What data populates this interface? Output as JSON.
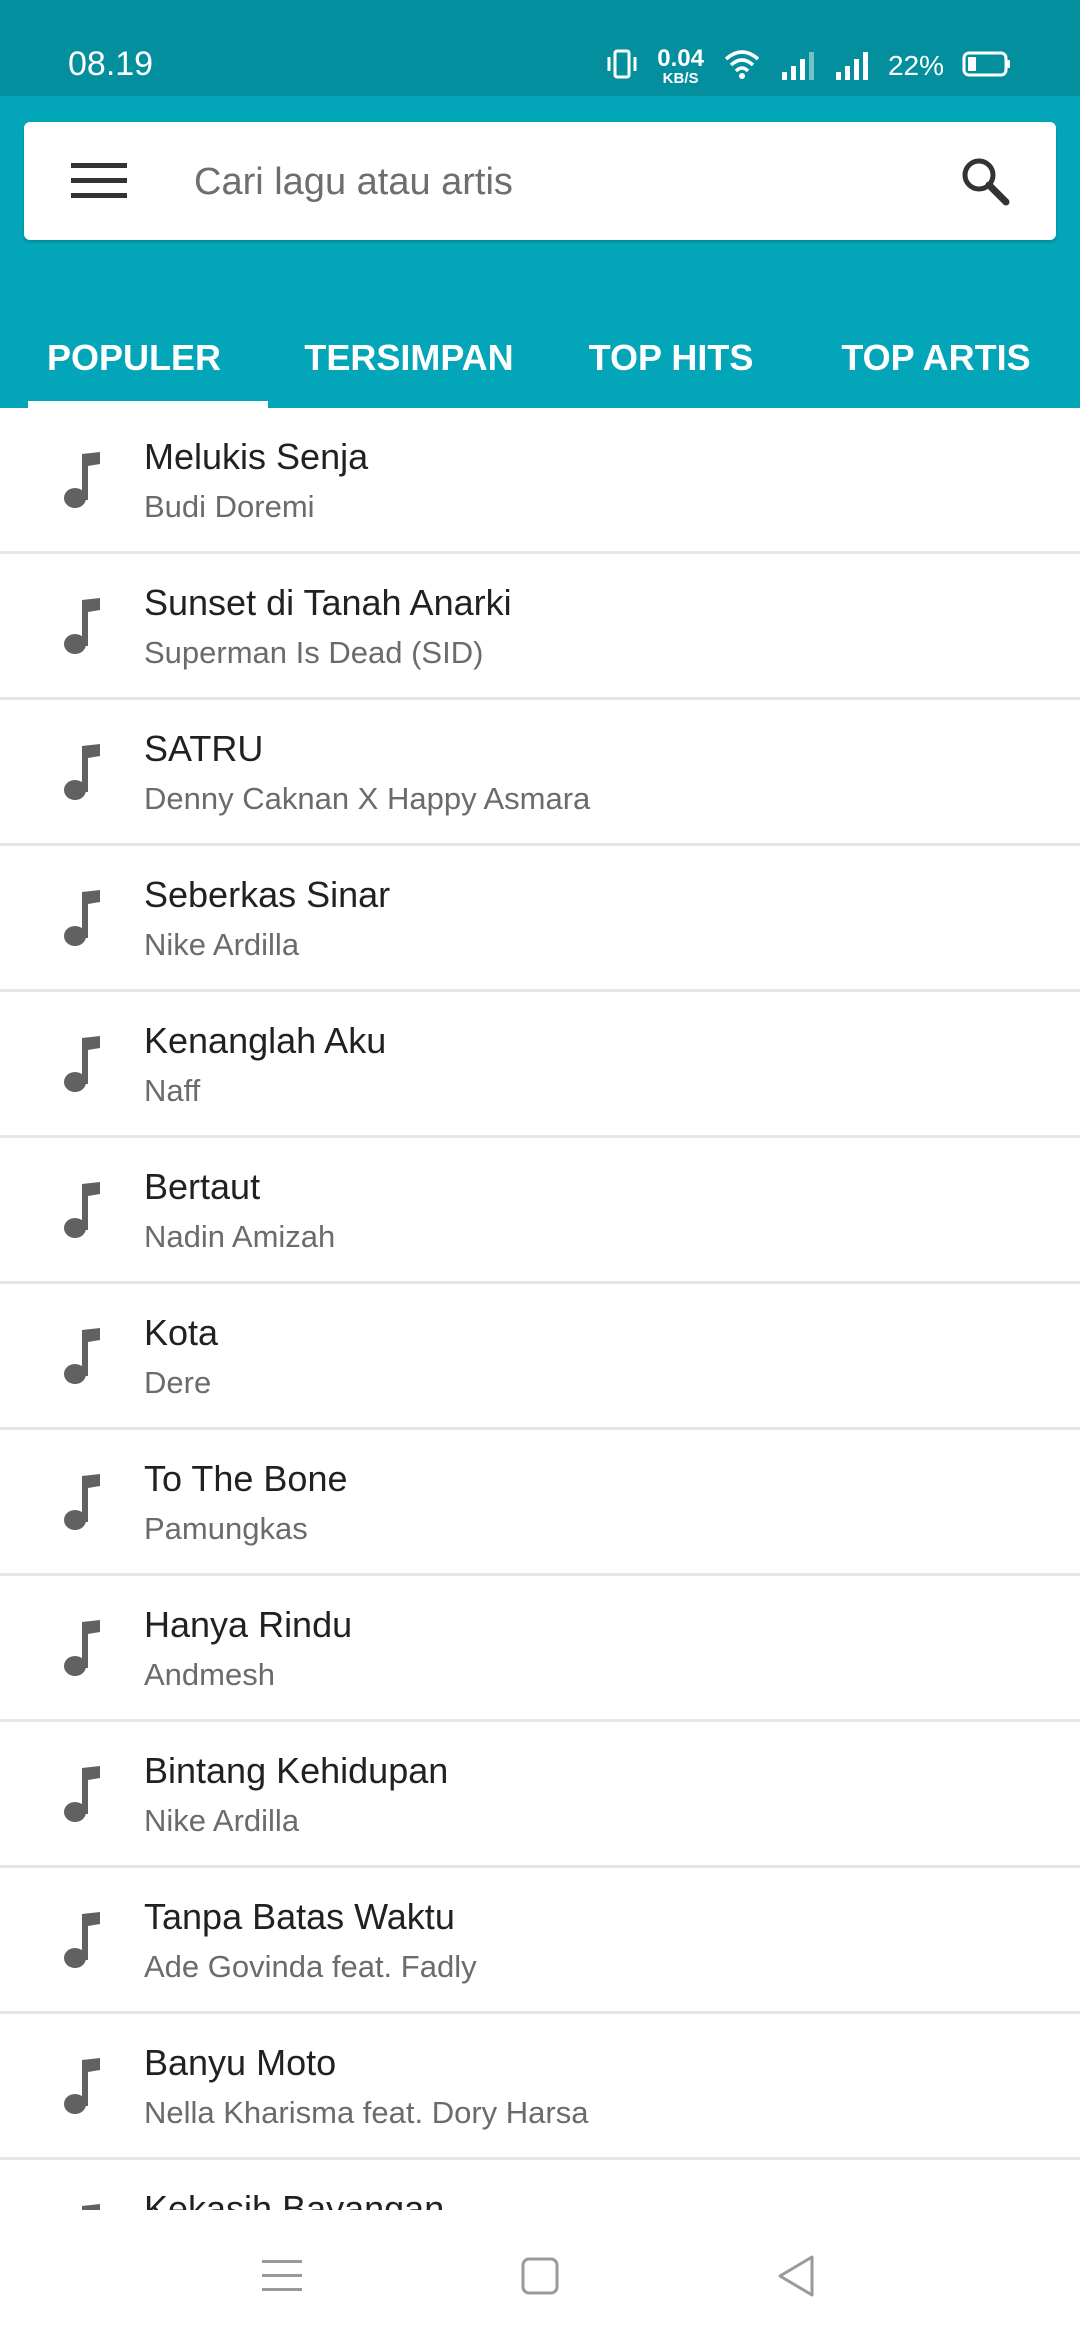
{
  "status_bar": {
    "time": "08.19",
    "net_speed_value": "0.04",
    "net_speed_unit": "KB/S",
    "battery_percent": "22%"
  },
  "search": {
    "placeholder": "Cari lagu atau artis"
  },
  "tabs": [
    {
      "label": "POPULER",
      "active": true
    },
    {
      "label": "TERSIMPAN",
      "active": false
    },
    {
      "label": "TOP HITS",
      "active": false
    },
    {
      "label": "TOP ARTIS",
      "active": false
    }
  ],
  "songs": [
    {
      "title": "Melukis Senja",
      "artist": "Budi Doremi"
    },
    {
      "title": "Sunset di Tanah Anarki",
      "artist": "Superman Is Dead (SID)"
    },
    {
      "title": "SATRU",
      "artist": "Denny Caknan X Happy Asmara"
    },
    {
      "title": "Seberkas Sinar",
      "artist": "Nike Ardilla"
    },
    {
      "title": "Kenanglah Aku",
      "artist": "Naff"
    },
    {
      "title": "Bertaut",
      "artist": "Nadin Amizah"
    },
    {
      "title": "Kota",
      "artist": "Dere"
    },
    {
      "title": "To The Bone",
      "artist": "Pamungkas"
    },
    {
      "title": "Hanya Rindu",
      "artist": "Andmesh"
    },
    {
      "title": "Bintang Kehidupan",
      "artist": "Nike Ardilla"
    },
    {
      "title": "Tanpa Batas Waktu",
      "artist": "Ade Govinda feat. Fadly"
    },
    {
      "title": "Banyu Moto",
      "artist": "Nella Kharisma feat. Dory Harsa"
    },
    {
      "title": "Kekasih Bayangan",
      "artist": ""
    }
  ],
  "colors": {
    "status_bar": "#048f9e",
    "app_bar": "#03a5b8",
    "icon_gray": "#616161"
  }
}
